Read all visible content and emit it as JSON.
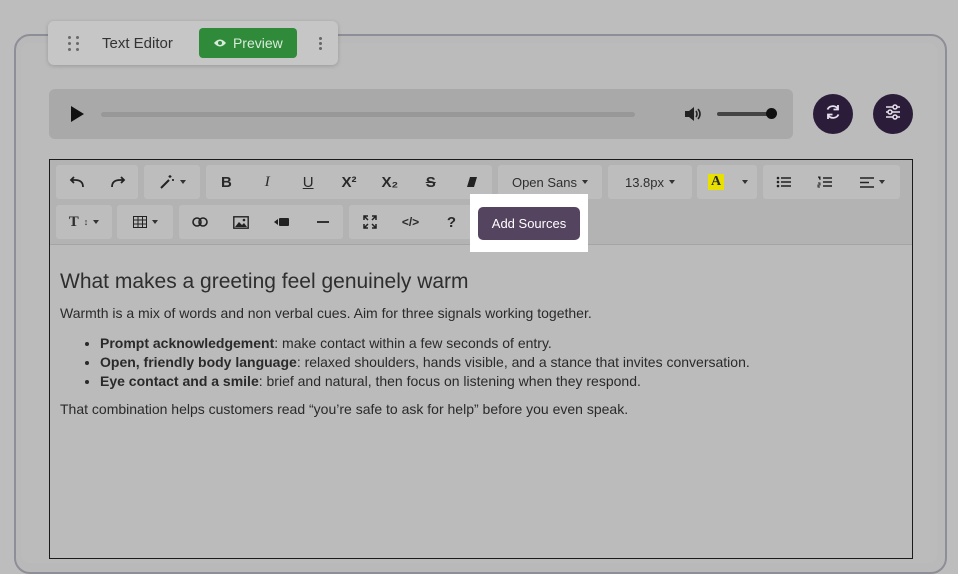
{
  "titlebar": {
    "title": "Text Editor",
    "preview_label": "Preview"
  },
  "toolbar": {
    "font_family": "Open Sans",
    "font_size": "13.8px",
    "bold": "B",
    "italic": "I",
    "underline": "U",
    "superscript": "X²",
    "subscript": "X₂",
    "strikethrough": "S",
    "text_color_glyph": "A",
    "help": "?",
    "code_view": "</>",
    "add_sources_label": "Add Sources"
  },
  "document": {
    "heading": "What makes a greeting feel genuinely warm",
    "intro": "Warmth is a mix of words and non verbal cues. Aim for three signals working together.",
    "bullets": [
      {
        "term": "Prompt acknowledgement",
        "text": ": make contact within a few seconds of entry."
      },
      {
        "term": "Open, friendly body language",
        "text": ": relaxed shoulders, hands visible, and a stance that invites conversation."
      },
      {
        "term": "Eye contact and a smile",
        "text": ": brief and natural, then focus on listening when they respond."
      }
    ],
    "closing": "That combination helps customers read “you’re safe to ask for help” before you even speak."
  },
  "audio": {
    "progress": 0.0,
    "volume": 1.0
  },
  "colors": {
    "preview_green": "#2f8a3a",
    "accent_purple": "#54445f",
    "round_button": "#2b1d3a",
    "highlight_yellow": "#e8e000"
  }
}
